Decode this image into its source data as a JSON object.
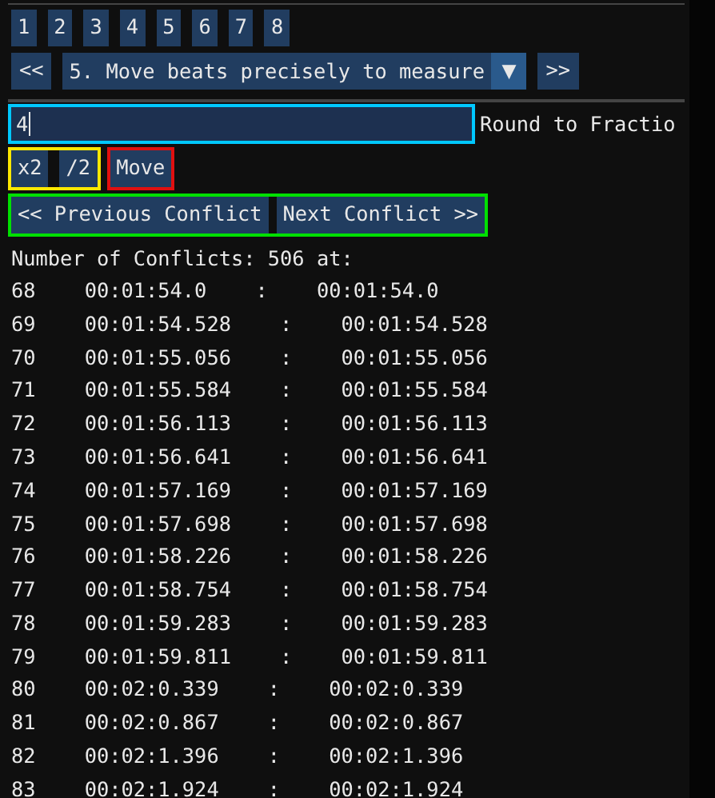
{
  "page_buttons": [
    "1",
    "2",
    "3",
    "4",
    "5",
    "6",
    "7",
    "8"
  ],
  "step_nav": {
    "prev": "<<",
    "dropdown": {
      "value": "5. Move beats precisely to measure",
      "arrow": "▼"
    },
    "next": ">>"
  },
  "fraction_field": {
    "value": "4",
    "label": "Round to Fractio"
  },
  "scale_buttons": [
    "x2",
    "/2"
  ],
  "move_button": "Move",
  "conflict_nav": [
    "<< Previous Conflict",
    "Next Conflict >>"
  ],
  "summary": "Number of Conflicts: 506 at:",
  "conflicts": [
    {
      "index": "68",
      "start": "00:01:54.0",
      "sep": ":",
      "end": "00:01:54.0"
    },
    {
      "index": "69",
      "start": "00:01:54.528",
      "sep": ":",
      "end": "00:01:54.528"
    },
    {
      "index": "70",
      "start": "00:01:55.056",
      "sep": ":",
      "end": "00:01:55.056"
    },
    {
      "index": "71",
      "start": "00:01:55.584",
      "sep": ":",
      "end": "00:01:55.584"
    },
    {
      "index": "72",
      "start": "00:01:56.113",
      "sep": ":",
      "end": "00:01:56.113"
    },
    {
      "index": "73",
      "start": "00:01:56.641",
      "sep": ":",
      "end": "00:01:56.641"
    },
    {
      "index": "74",
      "start": "00:01:57.169",
      "sep": ":",
      "end": "00:01:57.169"
    },
    {
      "index": "75",
      "start": "00:01:57.698",
      "sep": ":",
      "end": "00:01:57.698"
    },
    {
      "index": "76",
      "start": "00:01:58.226",
      "sep": ":",
      "end": "00:01:58.226"
    },
    {
      "index": "77",
      "start": "00:01:58.754",
      "sep": ":",
      "end": "00:01:58.754"
    },
    {
      "index": "78",
      "start": "00:01:59.283",
      "sep": ":",
      "end": "00:01:59.283"
    },
    {
      "index": "79",
      "start": "00:01:59.811",
      "sep": ":",
      "end": "00:01:59.811"
    },
    {
      "index": "80",
      "start": "00:02:0.339",
      "sep": ":",
      "end": "00:02:0.339"
    },
    {
      "index": "81",
      "start": "00:02:0.867",
      "sep": ":",
      "end": "00:02:0.867"
    },
    {
      "index": "82",
      "start": "00:02:1.396",
      "sep": ":",
      "end": "00:02:1.396"
    },
    {
      "index": "83",
      "start": "00:02:1.924",
      "sep": ":",
      "end": "00:02:1.924"
    }
  ]
}
